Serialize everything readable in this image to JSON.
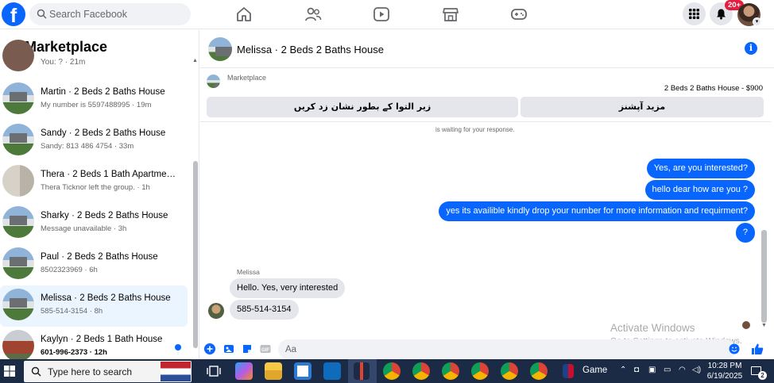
{
  "nav": {
    "search_placeholder": "Search Facebook",
    "notification_count": "20+",
    "icons": [
      "facebook-logo",
      "home-icon",
      "friends-icon",
      "video-icon",
      "marketplace-icon",
      "gaming-icon",
      "menu-grid-icon",
      "bell-icon"
    ]
  },
  "sidebar": {
    "title": "Marketplace",
    "partial_item_sub": "You: ? · 21m",
    "conversations": [
      {
        "name": "Martin · 2 Beds 2 Baths House",
        "sub": "My number is 5597488995 · 19m",
        "scene": "house",
        "active": false,
        "unread": false
      },
      {
        "name": "Sandy · 2 Beds 2 Baths House",
        "sub": "Sandy: 813 486 4754 · 33m",
        "scene": "house",
        "active": false,
        "unread": false
      },
      {
        "name": "Thera · 2 Beds 1 Bath Apartment...",
        "sub": "Thera Ticknor left the group. · 1h",
        "scene": "room",
        "active": false,
        "unread": false
      },
      {
        "name": "Sharky · 2 Beds 2 Baths House",
        "sub": "Message unavailable · 3h",
        "scene": "house",
        "active": false,
        "unread": false
      },
      {
        "name": "Paul · 2 Beds 2 Baths House",
        "sub": "8502323969 · 6h",
        "scene": "house",
        "active": false,
        "unread": false
      },
      {
        "name": "Melissa · 2 Beds 2 Baths House",
        "sub": "585-514-3154 · 8h",
        "scene": "house",
        "active": true,
        "unread": false
      },
      {
        "name": "Kaylyn · 2 Beds 1 Bath House",
        "sub": "601-996-2373 · 12h",
        "scene": "brick",
        "active": false,
        "unread": true
      }
    ]
  },
  "conversation": {
    "title": "Melissa · 2 Beds 2 Baths House",
    "listing_source": "Marketplace",
    "listing_detail": "2 Beds 2 Baths House - $900",
    "button_mark_pending": "زیر التوا کے بطور نشان زد کریں",
    "button_more_options": "مزید آپشنز",
    "system_note": "is waiting for your response.",
    "outgoing": [
      "Yes, are you interested?",
      "hello dear how are you ?",
      "yes its availible kindly drop your number for more information and requirment?",
      "?"
    ],
    "sender_name": "Melissa",
    "incoming": [
      "Hello. Yes, very interested",
      "585-514-3154"
    ],
    "composer_placeholder": "Aa"
  },
  "watermark": {
    "line1": "Activate Windows",
    "line2": "Go to Settings to activate Windows."
  },
  "taskbar": {
    "search_label": "Type here to search",
    "game_label": "Game",
    "time": "10:28 PM",
    "date": "6/19/2025",
    "notification_count": "2"
  },
  "colors": {
    "brand_blue": "#0866ff",
    "active_row": "#ebf5ff",
    "bubble_in": "#e4e6eb",
    "badge_red": "#e41e3f",
    "taskbar": "#1c2b45"
  }
}
